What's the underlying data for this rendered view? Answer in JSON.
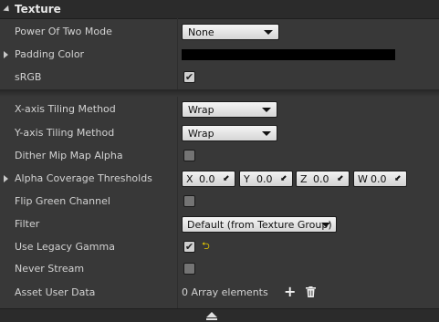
{
  "section": {
    "title": "Texture"
  },
  "rows": {
    "power_of_two": {
      "label": "Power Of Two Mode",
      "value": "None"
    },
    "padding_color": {
      "label": "Padding Color",
      "color": "#000000"
    },
    "srgb": {
      "label": "sRGB",
      "checked": true
    },
    "x_tiling": {
      "label": "X-axis Tiling Method",
      "value": "Wrap"
    },
    "y_tiling": {
      "label": "Y-axis Tiling Method",
      "value": "Wrap"
    },
    "dither_mip": {
      "label": "Dither Mip Map Alpha",
      "checked": false
    },
    "alpha_coverage": {
      "label": "Alpha Coverage Thresholds",
      "x_axis": "X",
      "x_value": "0.0",
      "y_axis": "Y",
      "y_value": "0.0",
      "z_axis": "Z",
      "z_value": "0.0",
      "w_axis": "W",
      "w_value": "0.0"
    },
    "flip_green": {
      "label": "Flip Green Channel",
      "checked": false
    },
    "filter": {
      "label": "Filter",
      "value": "Default (from Texture Group)"
    },
    "legacy_gamma": {
      "label": "Use Legacy Gamma",
      "checked": true
    },
    "never_stream": {
      "label": "Never Stream",
      "checked": false
    },
    "asset_user_data": {
      "label": "Asset User Data",
      "value": "0 Array elements"
    }
  },
  "icons": {
    "check": "✔",
    "reset": "⮌",
    "plus": "+",
    "drag": "⬋"
  },
  "colors": {
    "panel_bg": "#383838",
    "header_bg": "#2b2b2b",
    "accent_reset": "#e5c800"
  }
}
